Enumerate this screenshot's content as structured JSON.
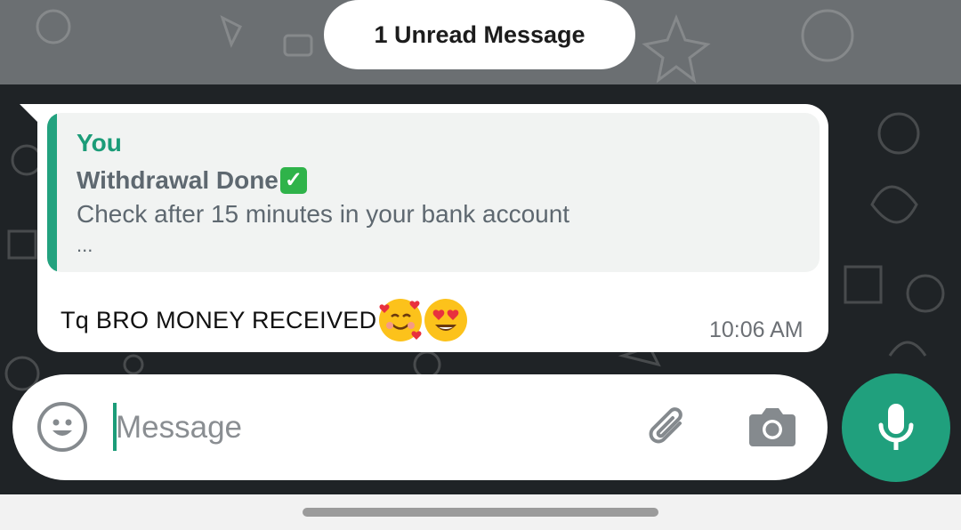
{
  "chat": {
    "unread_banner": "1 Unread Message"
  },
  "message": {
    "quote": {
      "author": "You",
      "title": "Withdrawal Done",
      "title_emoji": "check-mark-button-icon",
      "body": "Check after 15 minutes in your bank account",
      "more": "..."
    },
    "text": "Tq BRO MONEY RECEIVED",
    "emojis": [
      "smiling-face-with-hearts-icon",
      "heart-eyes-icon"
    ],
    "time": "10:06 AM"
  },
  "composer": {
    "placeholder": "Message",
    "icons": [
      "emoji-icon",
      "paperclip-icon",
      "camera-icon",
      "microphone-icon"
    ]
  },
  "colors": {
    "accent": "#20a07d",
    "quote_author": "#1b9c78",
    "bubble": "#ffffff",
    "chat_background": "#1f2326",
    "header_band": "#6b6f72"
  }
}
